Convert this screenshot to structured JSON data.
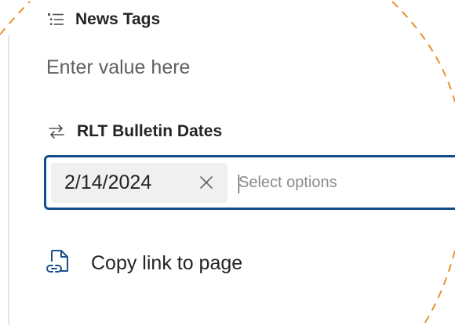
{
  "news_tags": {
    "label": "News Tags",
    "icon": "text-bullet-list-icon",
    "placeholder": "Enter value here"
  },
  "rlt_bulletin_dates": {
    "label": "RLT Bulletin Dates",
    "icon": "arrow-swap-icon",
    "selected": [
      "2/14/2024"
    ],
    "placeholder": "Select options"
  },
  "actions": {
    "copy_link_label": "Copy link to page",
    "copy_link_icon": "document-link-icon"
  },
  "colors": {
    "accent_border": "#0f4c8a",
    "link_icon": "#1f4e8c",
    "decor_dashes": "#e8912d",
    "chip_bg": "#f0f0f0"
  }
}
